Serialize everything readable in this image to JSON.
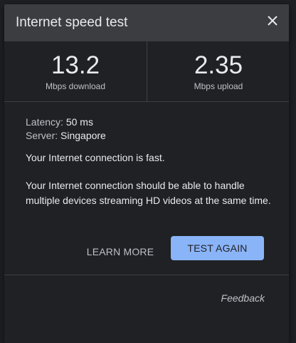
{
  "dialog": {
    "title": "Internet speed test",
    "close_icon": "close-icon"
  },
  "speeds": {
    "download_value": "13.2",
    "download_unit": "Mbps download",
    "upload_value": "2.35",
    "upload_unit": "Mbps upload"
  },
  "info": {
    "latency_label": "Latency: ",
    "latency_value": "50 ms",
    "server_label": "Server: ",
    "server_value": "Singapore"
  },
  "messages": {
    "fast": "Your Internet connection is fast.",
    "detail": "Your Internet connection should be able to handle multiple devices streaming HD videos at the same time."
  },
  "actions": {
    "learn_more": "LEARN MORE",
    "test_again": "TEST AGAIN",
    "feedback": "Feedback"
  },
  "colors": {
    "header_bg": "#3c3d40",
    "dialog_bg": "#202124",
    "accent": "#8ab4f8",
    "text_primary": "#e8eaed",
    "text_secondary": "#bdc1c6"
  }
}
